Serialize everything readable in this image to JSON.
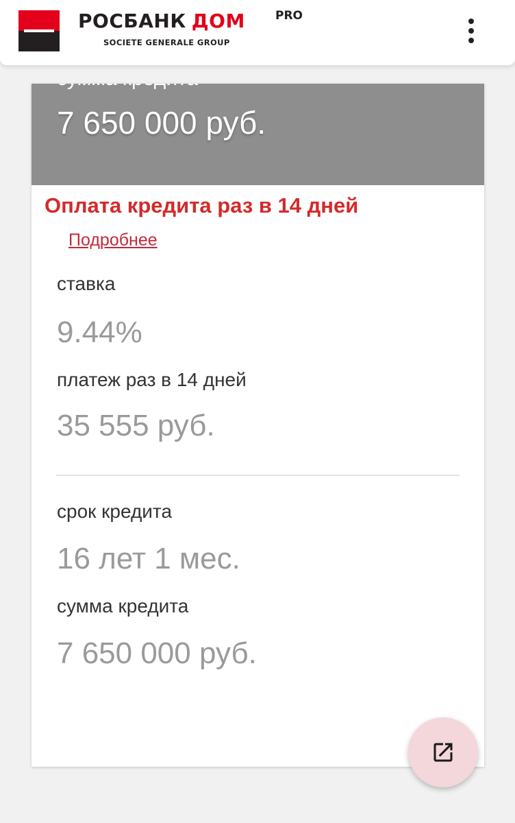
{
  "header": {
    "brand_main": "РОСБАНК",
    "brand_accent": "ДОМ",
    "brand_pro": "PRO",
    "brand_sub": "SOCIETE GENERALE GROUP",
    "menu_icon": "more-vertical-icon"
  },
  "banner": {
    "label": "сумма кредита",
    "value": "7 650 000 руб."
  },
  "notice": {
    "text": "Оплата кредита раз в 14 дней",
    "link": "Подробнее"
  },
  "details": {
    "rate_label": "ставка",
    "rate_value": "9.44%",
    "payment_label": "платеж раз в 14 дней",
    "payment_value": "35 555 руб.",
    "term_label": "срок кредита",
    "term_value": "16 лет 1 мес.",
    "amount_label": "сумма кредита",
    "amount_value": "7 650 000 руб."
  },
  "fab": {
    "icon": "open-in-new-icon"
  },
  "colors": {
    "brand_red": "#e2001a",
    "brand_dark": "#231f20",
    "notice_red": "#d42a2a",
    "banner_gray": "#8e8e8e",
    "fab_bg": "#f3d7db"
  }
}
